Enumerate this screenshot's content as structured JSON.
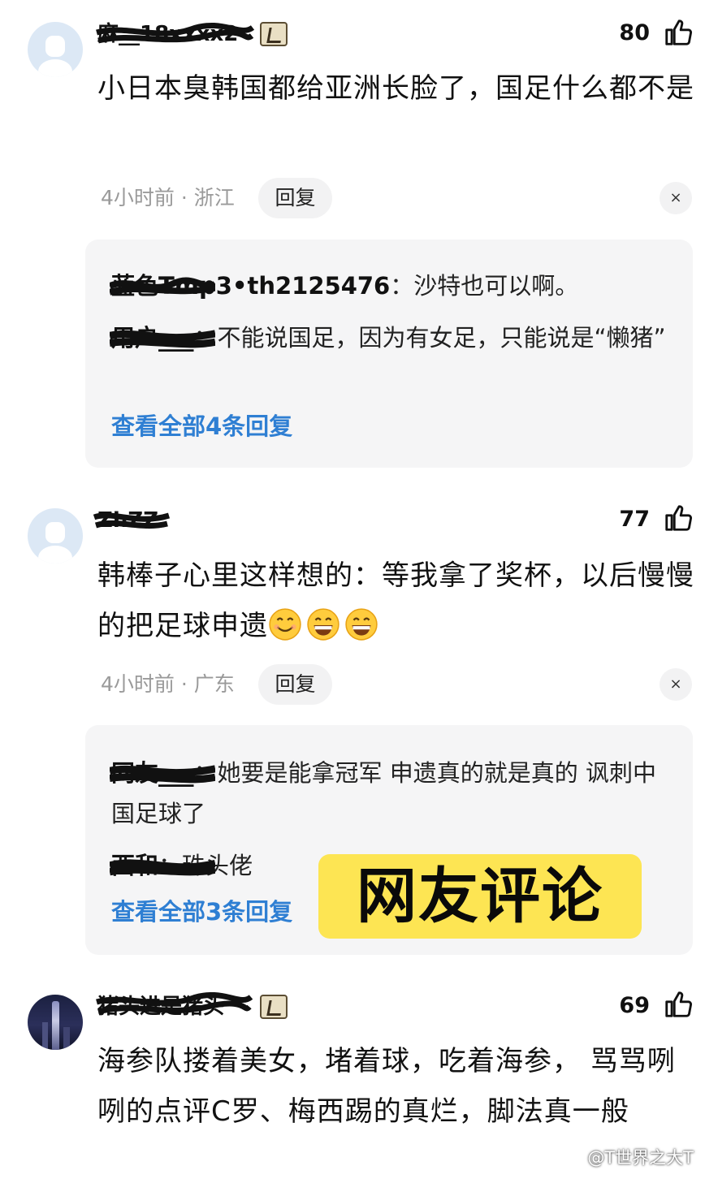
{
  "comments": [
    {
      "username": "麻__18xxxx2",
      "likes": "80",
      "text": "小日本臭韩国都给亚洲长脸了，国足什么都不是",
      "time": "4小时前",
      "location": "浙江",
      "reply_label": "回复",
      "close_label": "×",
      "replies": [
        {
          "name": "蓝色Tmp3•th2125476",
          "text": "沙特也可以啊。"
        },
        {
          "name": "用户___",
          "text": "不能说国足，因为有女足，只能说是“懒猪”"
        }
      ],
      "view_all": "查看全部4条回复"
    },
    {
      "username": "ZhZZ",
      "likes": "77",
      "text": "韩棒子心里这样想的：等我拿了奖杯，以后慢慢的把足球申遗",
      "time": "4小时前",
      "location": "广东",
      "reply_label": "回复",
      "close_label": "×",
      "replies": [
        {
          "name": "网友___",
          "text": "她要是能拿冠军 申遗真的就是真的 讽刺中国足球了"
        },
        {
          "name": "西和",
          "text": "珠头佬"
        }
      ],
      "view_all": "查看全部3条回复"
    },
    {
      "username": "猪头进是猪头",
      "likes": "69",
      "text": "海参队搂着美女，堵着球，吃着海参， 骂骂咧咧的点评C罗、梅西踢的真烂，脚法真一般"
    }
  ],
  "overlay_label": "网友评论",
  "watermark": "@T世界之大T",
  "colors": {
    "link": "#2f7fd3",
    "overlay_bg": "#fde553",
    "reply_bg": "#f5f5f6"
  }
}
